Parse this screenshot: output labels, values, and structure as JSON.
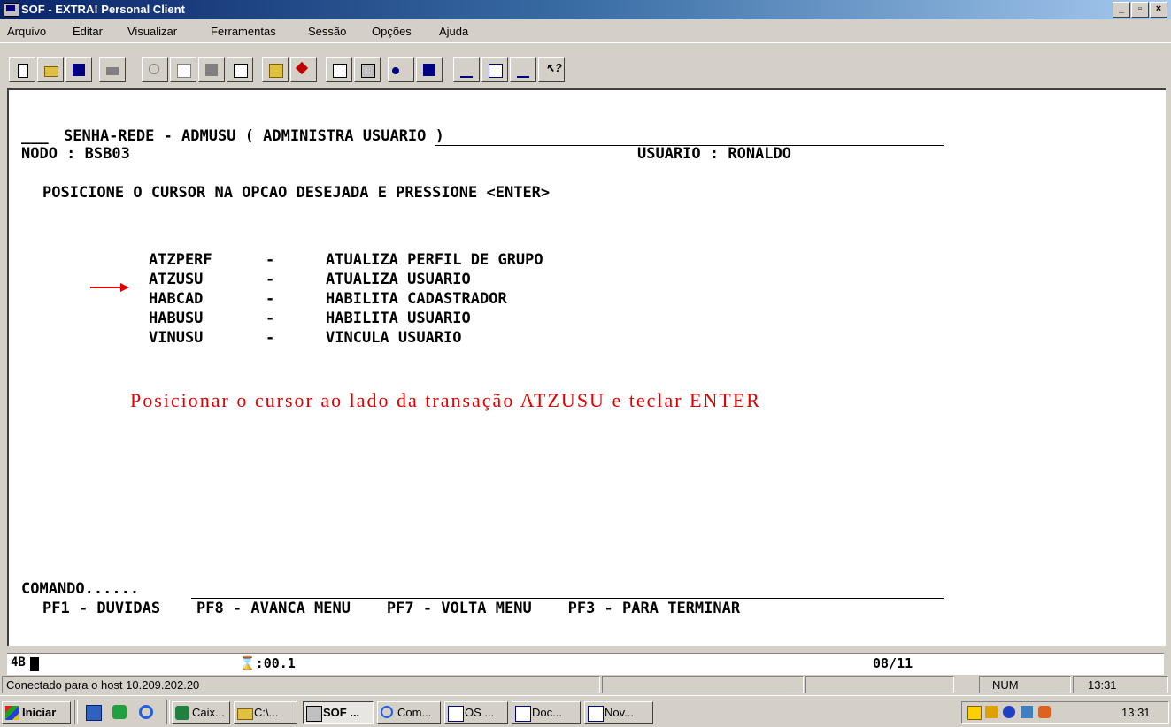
{
  "window": {
    "title": "SOF - EXTRA! Personal Client",
    "buttons": [
      "_",
      "▫",
      "×"
    ]
  },
  "menu": [
    "Arquivo",
    "Editar",
    "Visualizar",
    "Ferramentas",
    "Sessão",
    "Opções",
    "Ajuda"
  ],
  "toolbar": {
    "groups": [
      [
        "new-file-icon",
        "open-folder-icon",
        "save-icon"
      ],
      [
        "print-icon"
      ],
      [
        "cut-icon",
        "copy-icon",
        "paste-icon",
        "transfer-icon"
      ],
      [
        "open-file-icon",
        "tools-icon"
      ],
      [
        "macro-icon",
        "display-icon"
      ],
      [
        "record-icon",
        "edit-icon"
      ],
      [
        "settings-icon",
        "dialog-icon",
        "quickpad-icon",
        "help-icon"
      ]
    ]
  },
  "screen": {
    "field_prefix": "___",
    "header_title": "SENHA-REDE - ADMUSU ( ADMINISTRA USUARIO )",
    "nodo_label": "NODO : BSB03",
    "usuario_label": "USUARIO : RONALDO",
    "instruction": "POSICIONE O CURSOR NA OPCAO DESEJADA E PRESSIONE <ENTER>",
    "options": [
      {
        "code": "ATZPERF",
        "sep": "-",
        "desc": "ATUALIZA PERFIL DE GRUPO"
      },
      {
        "code": "ATZUSU",
        "sep": "-",
        "desc": "ATUALIZA USUARIO"
      },
      {
        "code": "HABCAD",
        "sep": "-",
        "desc": "HABILITA CADASTRADOR"
      },
      {
        "code": "HABUSU",
        "sep": "-",
        "desc": "HABILITA USUARIO"
      },
      {
        "code": "VINUSU",
        "sep": "-",
        "desc": "VINCULA USUARIO"
      }
    ],
    "annotation": "Posicionar o cursor ao lado da transação ATZUSU e teclar ENTER",
    "comando_label": "COMANDO......",
    "pf_keys": "PF1 - DUVIDAS    PF8 - AVANCA MENU    PF7 - VOLTA MENU    PF3 - PARA TERMINAR"
  },
  "oia": {
    "mode": "4B",
    "timer": "⌛:00.1",
    "cursor_pos": "08/11"
  },
  "status": {
    "connection": "Conectado para o host 10.209.202.20",
    "num": "NUM",
    "time": "13:31"
  },
  "taskbar": {
    "start": "Iniciar",
    "quick_launch": [
      "desktop-icon",
      "outlook-icon",
      "ie-icon"
    ],
    "items": [
      "Caix...",
      "C:\\...",
      "SOF ...",
      "Com...",
      "OS ...",
      "Doc...",
      "Nov..."
    ],
    "clock": "13:31"
  },
  "colors": {
    "title_blue": "#0a246a",
    "annotation_red": "#e00000",
    "chrome": "#d4d0c8"
  }
}
